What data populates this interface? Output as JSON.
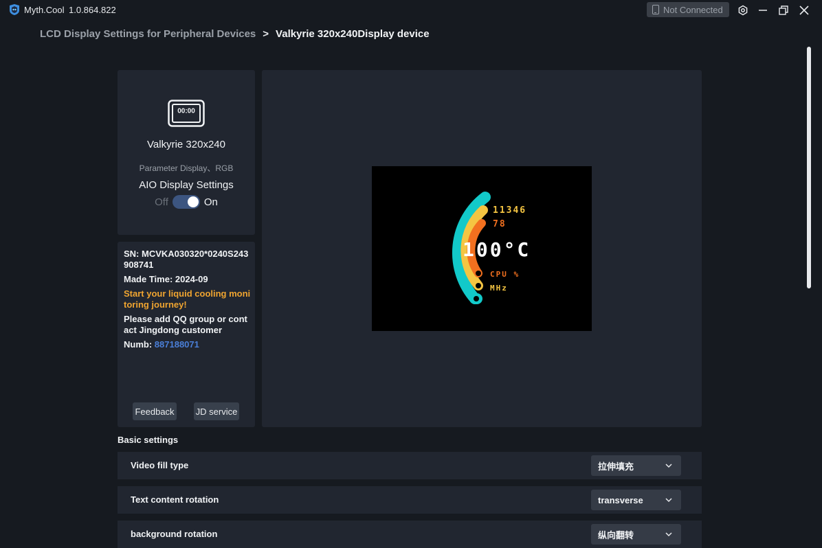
{
  "app": {
    "name": "Myth.Cool",
    "version": "1.0.864.822"
  },
  "connection": {
    "status": "Not Connected",
    "icon": "phone-icon"
  },
  "window_controls": [
    "settings-icon",
    "minimize-icon",
    "restore-icon",
    "close-icon"
  ],
  "breadcrumb": {
    "parent": "LCD Display Settings for Peripheral Devices",
    "separator": ">",
    "current": "Valkyrie 320x240Display device"
  },
  "device": {
    "icon_text": "00:00",
    "name": "Valkyrie 320x240",
    "type": "Parameter Display、RGB",
    "aio_title": "AIO Display Settings",
    "toggle_off_label": "Off",
    "toggle_on_label": "On",
    "toggle_state": "on"
  },
  "info": {
    "sn": "SN: MCVKA030320*0240S243908741",
    "made_time": "Made Time: 2024-09",
    "slogan": "Start your liquid cooling monitoring journey!",
    "contact": "Please add QQ group or contact Jingdong customer",
    "numb_label": "Numb:",
    "numb_value": "887188071",
    "feedback_label": "Feedback",
    "jd_label": "JD service"
  },
  "preview": {
    "value1": "11346",
    "value2": "78",
    "temp": "100°C",
    "label_cpu": "CPU %",
    "label_mhz": "MHz",
    "arc_colors": [
      "#12c9c9",
      "#f5c542",
      "#f2701f"
    ]
  },
  "settings": {
    "section_title": "Basic settings",
    "rows": [
      {
        "label": "Video fill type",
        "value": "拉伸填充"
      },
      {
        "label": "Text content rotation",
        "value": "transverse"
      },
      {
        "label": "background rotation",
        "value": "纵向翻转"
      }
    ]
  }
}
